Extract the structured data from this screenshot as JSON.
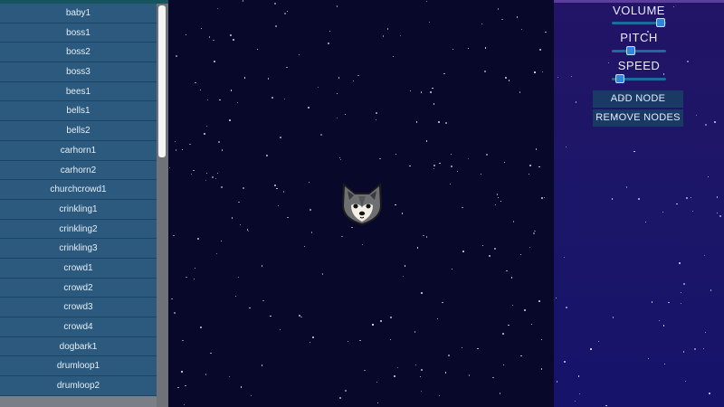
{
  "sounds": [
    "baby1",
    "boss1",
    "boss2",
    "boss3",
    "bees1",
    "bells1",
    "bells2",
    "carhorn1",
    "carhorn2",
    "churchcrowd1",
    "crinkling1",
    "crinkling2",
    "crinkling3",
    "crowd1",
    "crowd2",
    "crowd3",
    "crowd4",
    "dogbark1",
    "drumloop1",
    "drumloop2"
  ],
  "controls": {
    "volume_label": "VOLUME",
    "pitch_label": "PITCH",
    "speed_label": "SPEED",
    "add_node_label": "ADD NODE",
    "remove_nodes_label": "REMOVE NODES",
    "volume_level": 0.9,
    "pitch_level": 0.35,
    "speed_level": 0.15
  },
  "colors": {
    "list_item_bg": "#2b5a7e",
    "space_bg": "#08092a",
    "panel_bg": "#1c1668",
    "button_bg": "#1a3a66",
    "slider_thumb": "#2e86de"
  },
  "node_icon": "wolf-icon"
}
